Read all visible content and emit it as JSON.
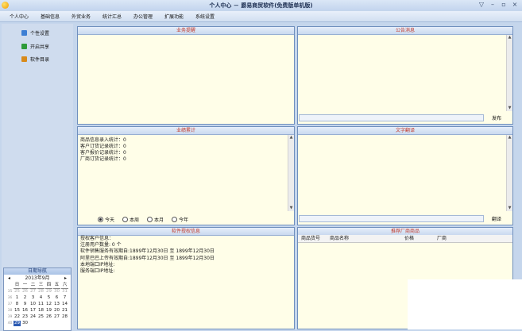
{
  "window": {
    "title": "个人中心 － 爵易商贸软件(免费版单机版)",
    "controls": [
      "▽",
      "–",
      "▫",
      "×"
    ]
  },
  "menu": [
    "个人中心",
    "基础信息",
    "外贸业务",
    "统计汇总",
    "办公管理",
    "扩展功能",
    "系统设置"
  ],
  "sidebar": {
    "items": [
      {
        "label": "个性设置",
        "icon": "settings-icon",
        "color": "#3d7fd4"
      },
      {
        "label": "开启共享",
        "icon": "share-icon",
        "color": "#2e9b3a"
      },
      {
        "label": "软件目录",
        "icon": "folder-icon",
        "color": "#d88a1a"
      }
    ]
  },
  "calendar": {
    "title": "日期导航",
    "month": "2013年9月",
    "prev": "◂",
    "next": "▸",
    "weekdays": [
      "日",
      "一",
      "二",
      "三",
      "四",
      "五",
      "六"
    ],
    "weeks": [
      "35",
      "36",
      "37",
      "38",
      "39",
      "40"
    ],
    "days": [
      [
        "25",
        "26",
        "27",
        "28",
        "29",
        "30",
        "31"
      ],
      [
        "1",
        "2",
        "3",
        "4",
        "5",
        "6",
        "7"
      ],
      [
        "8",
        "9",
        "10",
        "11",
        "12",
        "13",
        "14"
      ],
      [
        "15",
        "16",
        "17",
        "18",
        "19",
        "20",
        "21"
      ],
      [
        "22",
        "23",
        "24",
        "25",
        "26",
        "27",
        "28"
      ],
      [
        "29",
        "30",
        "",
        "",
        "",
        "",
        ""
      ]
    ],
    "selected": "29"
  },
  "panels": {
    "reminder": {
      "title": "业务提醒"
    },
    "notice": {
      "title": "公告消息",
      "button": "发布"
    },
    "stats": {
      "title": "业绩累计",
      "lines": [
        "商品信息录入统计：0",
        "客户订货记录统计：0",
        "客户报价记录统计：0",
        "厂商订货记录统计：0"
      ],
      "radios": [
        {
          "label": "今天",
          "checked": true
        },
        {
          "label": "本周",
          "checked": false
        },
        {
          "label": "本月",
          "checked": false
        },
        {
          "label": "今年",
          "checked": false
        }
      ]
    },
    "translate": {
      "title": "文字翻译",
      "button": "翻译"
    },
    "software": {
      "title": "软件授权信息",
      "lines": [
        "授权客户信息：",
        "注册用户数量: 0 个",
        "软件销售服务有效期自:1899年12月30日 至 1899年12月30日",
        "阿里巴巴上传有效期自:1899年12月30日 至 1899年12月30日",
        "本地端口IP地址:",
        "服务端口IP地址:"
      ]
    },
    "recommend": {
      "title": "推荐厂商商品",
      "columns": [
        "商品货号",
        "商品名称",
        "价格",
        "厂商"
      ]
    }
  }
}
